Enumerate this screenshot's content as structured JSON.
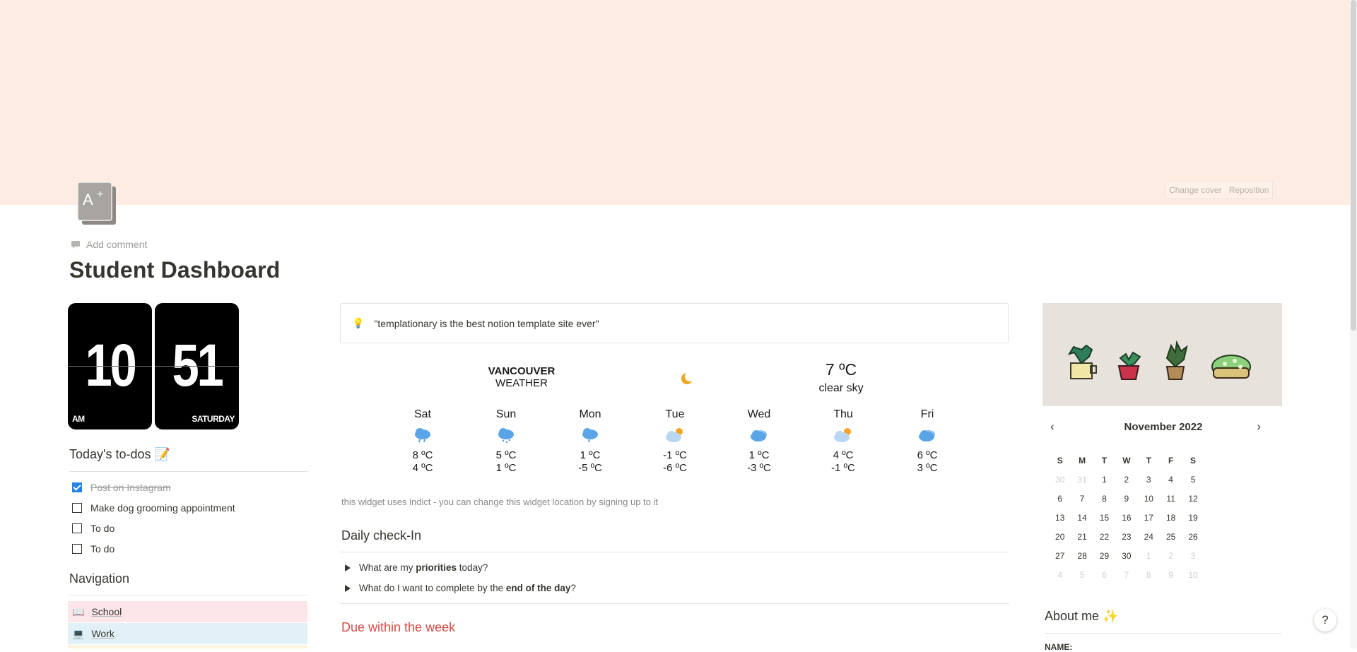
{
  "cover": {
    "change_cover": "Change cover",
    "reposition": "Reposition"
  },
  "page": {
    "add_comment": "Add comment",
    "title": "Student Dashboard",
    "icon": "grade-a-plus-icon"
  },
  "clock": {
    "hours": "10",
    "minutes": "51",
    "period": "AM",
    "day": "SATURDAY"
  },
  "todos": {
    "heading": "Today's to-dos 📝",
    "items": [
      {
        "label": "Post on Instagram",
        "checked": true
      },
      {
        "label": "Make dog grooming appointment",
        "checked": false
      },
      {
        "label": "To do",
        "checked": false
      },
      {
        "label": "To do",
        "checked": false
      }
    ]
  },
  "navigation": {
    "heading": "Navigation",
    "items": [
      {
        "icon": "📖",
        "label": "School",
        "color": "#fce6ea"
      },
      {
        "icon": "💻",
        "label": "Work",
        "color": "#e1f1f7"
      }
    ]
  },
  "quote": {
    "icon": "💡",
    "text": "\"templationary is the best notion template site ever\""
  },
  "weather": {
    "city": "VANCOUVER",
    "subtitle": "WEATHER",
    "current_temp": "7 ºC",
    "current_desc": "clear sky",
    "days": [
      {
        "day": "Sat",
        "icon": "rain-cloud-icon",
        "high": "8 ºC",
        "low": "4 ºC"
      },
      {
        "day": "Sun",
        "icon": "snow-cloud-icon",
        "high": "5 ºC",
        "low": "1 ºC"
      },
      {
        "day": "Mon",
        "icon": "rain-cloud-icon",
        "high": "1 ºC",
        "low": "-5 ºC"
      },
      {
        "day": "Tue",
        "icon": "partly-cloudy-icon",
        "high": "-1 ºC",
        "low": "-6 ºC"
      },
      {
        "day": "Wed",
        "icon": "cloud-icon",
        "high": "1 ºC",
        "low": "-3 ºC"
      },
      {
        "day": "Thu",
        "icon": "partly-cloudy-icon",
        "high": "4 ºC",
        "low": "-1 ºC"
      },
      {
        "day": "Fri",
        "icon": "cloud-icon",
        "high": "6 ºC",
        "low": "3 ºC"
      }
    ],
    "note": "this widget uses indict - you can change this widget location by signing up to it"
  },
  "checkin": {
    "heading": "Daily check-In",
    "q1_pre": "What are my ",
    "q1_bold": "priorities",
    "q1_post": " today?",
    "q2_pre": "What do I want to complete by the ",
    "q2_bold": "end of the day",
    "q2_post": "?"
  },
  "due": {
    "heading": "Due within the week"
  },
  "calendar": {
    "title": "November 2022",
    "prev": "‹",
    "next": "›",
    "dow": [
      "S",
      "M",
      "T",
      "W",
      "T",
      "F",
      "S"
    ],
    "cells": [
      {
        "d": "30",
        "m": true
      },
      {
        "d": "31",
        "m": true
      },
      {
        "d": "1"
      },
      {
        "d": "2"
      },
      {
        "d": "3"
      },
      {
        "d": "4"
      },
      {
        "d": "5"
      },
      {
        "d": "6"
      },
      {
        "d": "7"
      },
      {
        "d": "8"
      },
      {
        "d": "9"
      },
      {
        "d": "10"
      },
      {
        "d": "11"
      },
      {
        "d": "12"
      },
      {
        "d": "13"
      },
      {
        "d": "14"
      },
      {
        "d": "15"
      },
      {
        "d": "16"
      },
      {
        "d": "17"
      },
      {
        "d": "18"
      },
      {
        "d": "19"
      },
      {
        "d": "20"
      },
      {
        "d": "21"
      },
      {
        "d": "22"
      },
      {
        "d": "23"
      },
      {
        "d": "24"
      },
      {
        "d": "25"
      },
      {
        "d": "26"
      },
      {
        "d": "27"
      },
      {
        "d": "28"
      },
      {
        "d": "29"
      },
      {
        "d": "30"
      },
      {
        "d": "1",
        "m": true
      },
      {
        "d": "2",
        "m": true
      },
      {
        "d": "3",
        "m": true
      },
      {
        "d": "4",
        "m": true
      },
      {
        "d": "5",
        "m": true
      },
      {
        "d": "6",
        "m": true
      },
      {
        "d": "7",
        "m": true
      },
      {
        "d": "8",
        "m": true
      },
      {
        "d": "9",
        "m": true
      },
      {
        "d": "10",
        "m": true
      }
    ]
  },
  "about": {
    "heading": "About me ✨",
    "name_label": "NAME:"
  },
  "help": {
    "label": "?"
  }
}
